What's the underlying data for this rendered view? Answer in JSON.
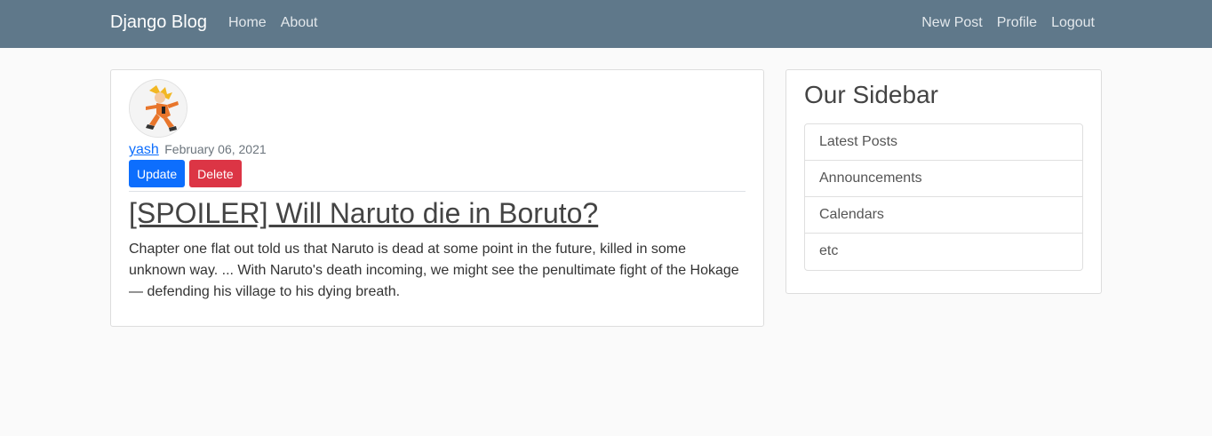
{
  "navbar": {
    "brand": "Django Blog",
    "left_links": [
      "Home",
      "About"
    ],
    "right_links": [
      "New Post",
      "Profile",
      "Logout"
    ]
  },
  "post": {
    "author": "yash",
    "date": "February 06, 2021",
    "update_label": "Update",
    "delete_label": "Delete",
    "title": "[SPOILER] Will Naruto die in Boruto?",
    "body_lines": [
      "Chapter one flat out told us that Naruto is dead at some point in the future, killed in some",
      "unknown way. ... With Naruto's death incoming, we might see the penultimate fight of the Hokage",
      "— defending his village to his dying breath."
    ]
  },
  "sidebar": {
    "title": "Our Sidebar",
    "items": [
      "Latest Posts",
      "Announcements",
      "Calendars",
      "etc"
    ]
  },
  "colors": {
    "navbar_bg": "#5f788a",
    "primary": "#0d6efd",
    "danger": "#dc3545"
  }
}
